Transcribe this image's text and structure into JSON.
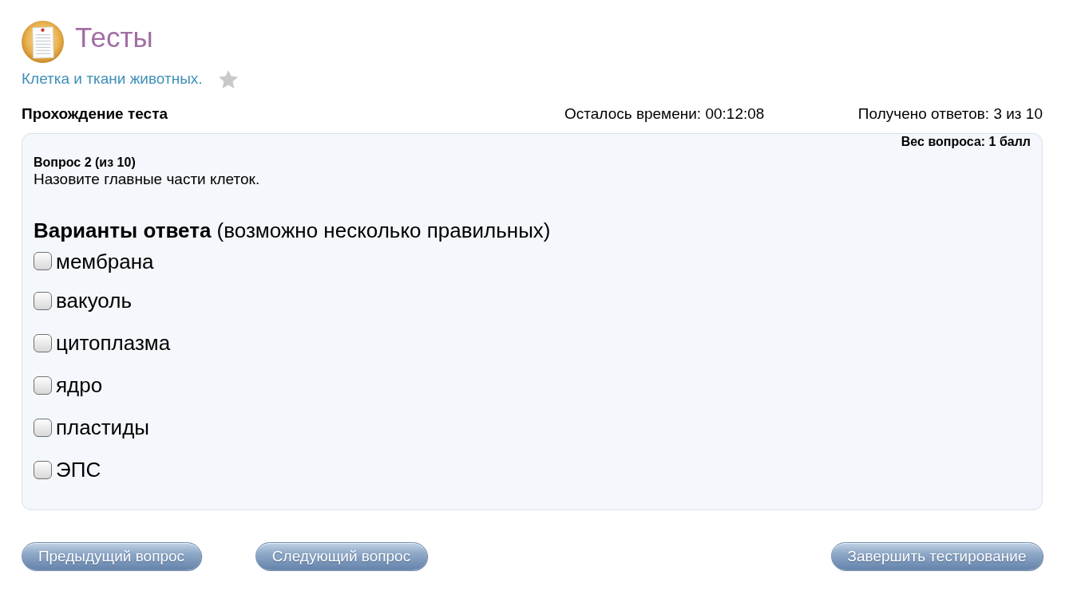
{
  "header": {
    "title": "Тесты",
    "test_name": "Клетка и ткани животных.",
    "favorite": false
  },
  "status": {
    "label": "Прохождение теста",
    "time_left": "Осталось времени: 00:12:08",
    "answered": "Получено ответов: 3 из 10"
  },
  "question": {
    "weight": "Вес вопроса: 1 балл",
    "number": "Вопрос 2 (из 10)",
    "text": "Назовите главные части клеток.",
    "answers_heading": "**Варианты ответа** (возможно несколько правильных)",
    "options": [
      {
        "label": "мембрана",
        "checked": false
      },
      {
        "label": "вакуоль",
        "checked": false
      },
      {
        "label": "цитоплазма",
        "checked": false
      },
      {
        "label": "ядро",
        "checked": false
      },
      {
        "label": "пластиды",
        "checked": false
      },
      {
        "label": "ЭПС",
        "checked": false
      }
    ]
  },
  "buttons": [
    {
      "label": "Предыдущий вопрос",
      "kind": "prev"
    },
    {
      "label": "Следующий вопрос",
      "kind": "next"
    },
    {
      "label": "Завершить тестирование",
      "kind": "finish"
    }
  ]
}
